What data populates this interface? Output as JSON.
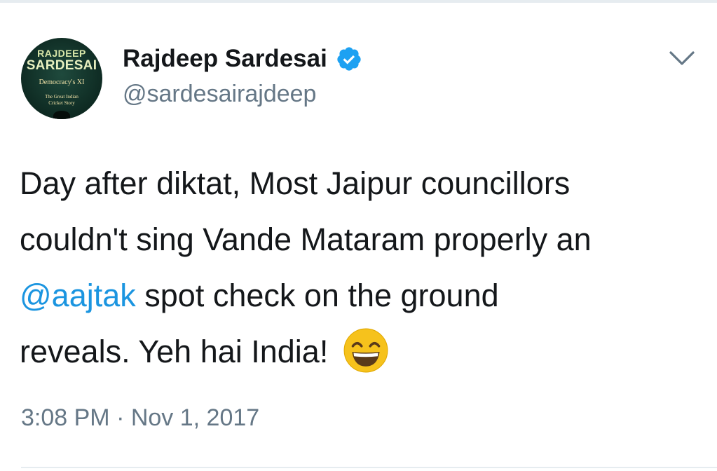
{
  "author": {
    "display_name": "Rajdeep Sardesai",
    "handle": "@sardesairajdeep",
    "verified": true,
    "avatar_text": {
      "line1": "RAJDEEP",
      "line2": "SARDESAI",
      "line3": "Democracy's XI",
      "line4": "The Great Indian Cricket Story"
    }
  },
  "tweet": {
    "line1": "Day after diktat, Most Jaipur councillors",
    "line2": "couldn't sing Vande Mataram properly an",
    "mention": "@aajtak",
    "line3_rest": " spot check on the ground",
    "line4": "reveals. Yeh hai India! ",
    "emoji": "grinning-face-with-smiling-eyes"
  },
  "timestamp": "3:08 PM · Nov 1, 2017",
  "colors": {
    "mention": "#1b95e0",
    "verified_badge": "#1da1f2",
    "secondary_text": "#657786",
    "primary_text": "#14171a"
  }
}
